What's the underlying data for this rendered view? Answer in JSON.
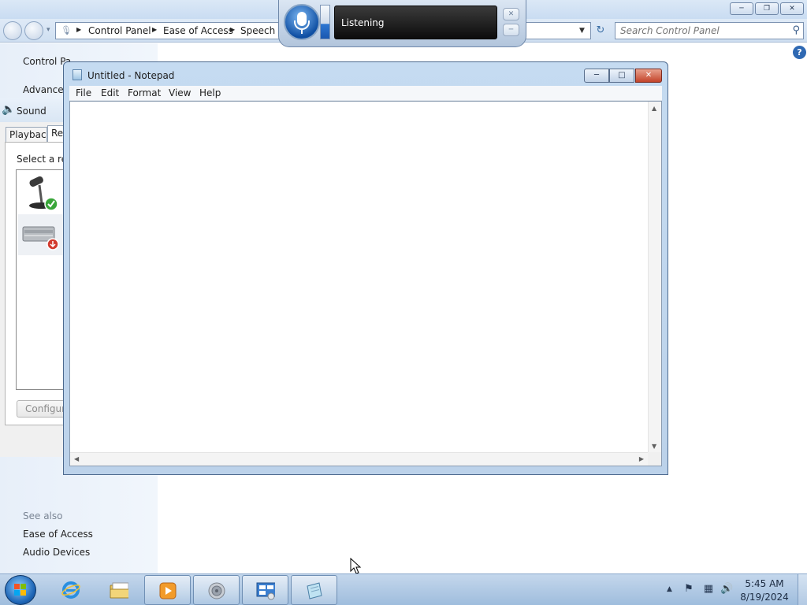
{
  "control_panel": {
    "breadcrumbs": [
      "Control Panel",
      "Ease of Access",
      "Speech R"
    ],
    "search_placeholder": "Search Control Panel",
    "sidebar": {
      "home_link": "Control Panel Home",
      "home_link_visible": "Control Pa",
      "advanced_link": "Advanced"
    },
    "see_also": {
      "heading": "See also",
      "links": [
        "Ease of Access",
        "Audio Devices"
      ]
    }
  },
  "sound_dialog": {
    "title": "Sound",
    "tabs": [
      "Playback",
      "Re"
    ],
    "instruction": "Select a reco",
    "configure_label": "Configure"
  },
  "notepad": {
    "title": "Untitled - Notepad",
    "menu": [
      "File",
      "Edit",
      "Format",
      "View",
      "Help"
    ],
    "content": ""
  },
  "speech_bar": {
    "status": "Listening",
    "level_fraction": 0.45
  },
  "taskbar": {
    "pinned": [
      {
        "name": "internet-explorer-icon",
        "open": false
      },
      {
        "name": "windows-explorer-icon",
        "open": false
      },
      {
        "name": "media-player-icon",
        "open": true
      },
      {
        "name": "sound-taskbar-icon",
        "open": true
      },
      {
        "name": "control-panel-taskbar-icon",
        "open": true
      },
      {
        "name": "notepad-taskbar-icon",
        "open": true
      }
    ],
    "clock": {
      "time": "5:45 AM",
      "date": "8/19/2024"
    }
  },
  "colors": {
    "accent": "#1d64b5",
    "close_button": "#c3432a",
    "listening_panel": "#0c0c0c"
  }
}
